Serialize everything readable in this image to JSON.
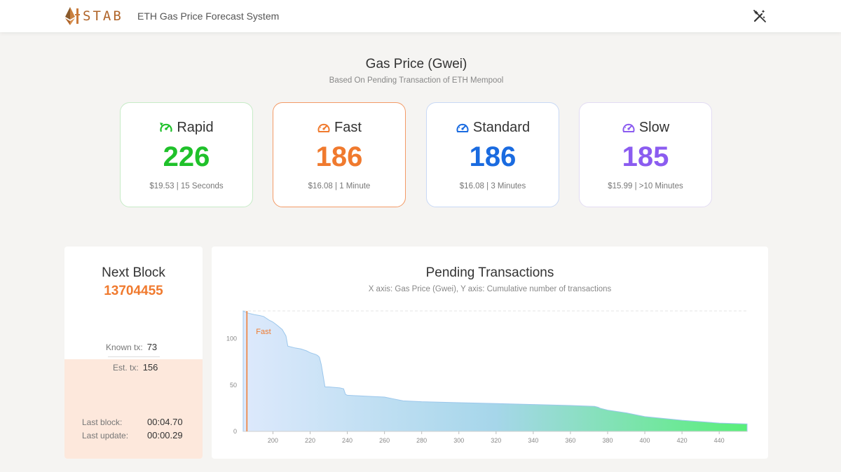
{
  "header": {
    "logo_text": "STAB",
    "title": "ETH Gas Price Forecast System",
    "theme_icon": "magic-wand-off-icon"
  },
  "gas": {
    "title": "Gas Price (Gwei)",
    "subtitle": "Based On Pending Transaction of ETH Mempool",
    "cards": [
      {
        "label": "Rapid",
        "price": "226",
        "detail": "$19.53 | 15 Seconds",
        "color": "#1fc12a",
        "icon": "rocket-speedometer-icon"
      },
      {
        "label": "Fast",
        "price": "186",
        "detail": "$16.08 | 1 Minute",
        "color": "#f07a2e",
        "icon": "speedometer-icon"
      },
      {
        "label": "Standard",
        "price": "186",
        "detail": "$16.08 | 3 Minutes",
        "color": "#1a6be0",
        "icon": "speedometer-icon"
      },
      {
        "label": "Slow",
        "price": "185",
        "detail": "$15.99 | >10 Minutes",
        "color": "#8b5cf0",
        "icon": "speedometer-icon"
      }
    ]
  },
  "block": {
    "title": "Next Block",
    "number": "13704455",
    "known_label": "Known tx:",
    "known_value": "73",
    "est_label": "Est. tx:",
    "est_value": "156",
    "last_block_label": "Last block:",
    "last_block_value": "00:04.70",
    "last_update_label": "Last update:",
    "last_update_value": "00:00.29"
  },
  "chart": {
    "title": "Pending Transactions",
    "subtitle": "X axis: Gas Price (Gwei), Y axis: Cumulative number of transactions",
    "marker_label": "Fast"
  },
  "chart_data": {
    "type": "area",
    "title": "Pending Transactions",
    "xlabel": "",
    "ylabel": "",
    "xlim": [
      184,
      455
    ],
    "ylim": [
      0,
      130
    ],
    "x_ticks": [
      200,
      220,
      240,
      260,
      280,
      300,
      320,
      340,
      360,
      380,
      400,
      420,
      440
    ],
    "y_ticks": [
      0,
      50,
      100
    ],
    "marker": {
      "label": "Fast",
      "x": 186,
      "color": "#f07a2e"
    },
    "series": [
      {
        "name": "",
        "x": [
          184,
          186,
          188,
          190,
          193,
          195,
          198,
          200,
          202,
          205,
          207,
          208,
          212,
          215,
          218,
          220,
          223,
          224,
          225,
          226,
          227,
          228,
          230,
          236,
          238,
          239,
          240,
          250,
          260,
          265,
          270,
          280,
          300,
          320,
          340,
          360,
          373,
          375,
          376,
          380,
          390,
          400,
          420,
          440,
          455
        ],
        "y": [
          130,
          128,
          127,
          126,
          125,
          124,
          120,
          118,
          115,
          110,
          103,
          92,
          90,
          89,
          87,
          85,
          83,
          82,
          80,
          72,
          60,
          48,
          48,
          47,
          46,
          40,
          39,
          38,
          37,
          35,
          33,
          32,
          31,
          30,
          29,
          28,
          27,
          26,
          25,
          23,
          20,
          16,
          12,
          9,
          8
        ]
      }
    ],
    "grid": false,
    "colors": [
      "#d6e6fb",
      "#58ef79"
    ]
  }
}
